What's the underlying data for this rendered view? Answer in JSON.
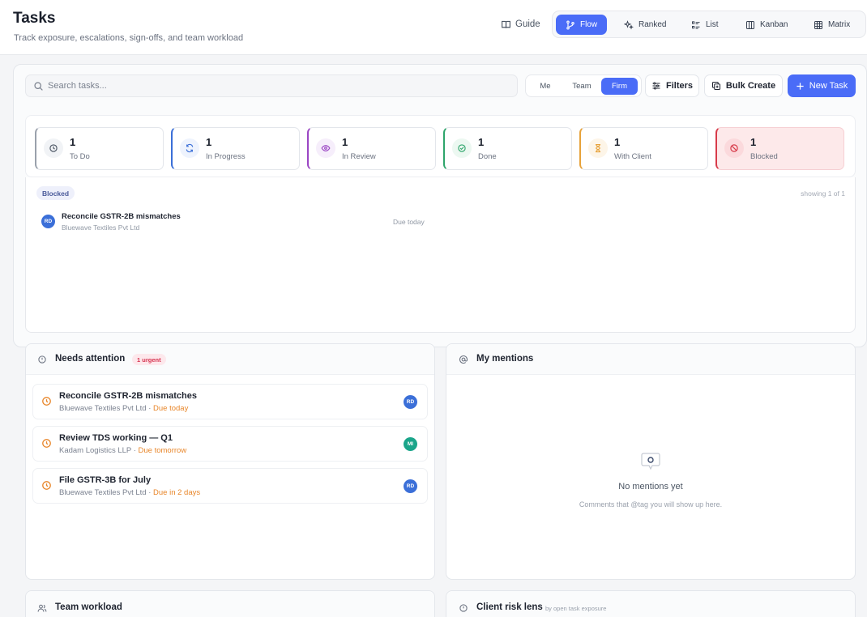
{
  "header": {
    "title": "Tasks",
    "subtitle": "Track exposure, escalations, sign-offs, and team workload",
    "guide_label": "Guide",
    "views": [
      {
        "label": "Flow",
        "icon": "branch-icon",
        "active": true
      },
      {
        "label": "Ranked",
        "icon": "sparkle-icon",
        "active": false
      },
      {
        "label": "List",
        "icon": "list-icon",
        "active": false
      },
      {
        "label": "Kanban",
        "icon": "columns-icon",
        "active": false
      },
      {
        "label": "Matrix",
        "icon": "grid-icon",
        "active": false
      }
    ]
  },
  "toolbar": {
    "search_placeholder": "Search tasks...",
    "scopes": [
      {
        "label": "Me",
        "active": false
      },
      {
        "label": "Team",
        "active": false
      },
      {
        "label": "Firm",
        "active": true
      }
    ],
    "filters_label": "Filters",
    "bulk_create_label": "Bulk Create",
    "new_task_label": "New Task"
  },
  "status_cards": [
    {
      "count": "1",
      "label": "To Do",
      "icon": "clock-icon",
      "color": "#6b7280"
    },
    {
      "count": "1",
      "label": "In Progress",
      "icon": "refresh-icon",
      "color": "#3b6fd8"
    },
    {
      "count": "1",
      "label": "In Review",
      "icon": "eye-icon",
      "color": "#9b46c4"
    },
    {
      "count": "1",
      "label": "Done",
      "icon": "check-circle-icon",
      "color": "#2ea56b"
    },
    {
      "count": "1",
      "label": "With Client",
      "icon": "hourglass-icon",
      "color": "#e7a23a"
    },
    {
      "count": "1",
      "label": "Blocked",
      "icon": "ban-icon",
      "color": "#d73a49"
    }
  ],
  "task_list": {
    "filter_badge": "Blocked",
    "showing": "showing 1 of 1",
    "rows": [
      {
        "initials": "RD",
        "title": "Reconcile GSTR-2B mismatches",
        "client": "Bluewave Textiles Pvt Ltd",
        "due": "Due today"
      }
    ]
  },
  "needs_attention": {
    "title": "Needs attention",
    "badge": "1 urgent",
    "items": [
      {
        "title": "Reconcile GSTR-2B mismatches",
        "client": "Bluewave Textiles Pvt Ltd",
        "sep": " · ",
        "due": "Due today",
        "initials": "RD",
        "avatar_color": "#3b6fd8"
      },
      {
        "title": "Review TDS working — Q1",
        "client": "Kadam Logistics LLP",
        "sep": " · ",
        "due": "Due tomorrow",
        "initials": "MI",
        "avatar_color": "#1aa58a"
      },
      {
        "title": "File GSTR-3B for July",
        "client": "Bluewave Textiles Pvt Ltd",
        "sep": " · ",
        "due": "Due in 2 days",
        "initials": "RD",
        "avatar_color": "#3b6fd8"
      }
    ]
  },
  "mentions": {
    "title": "My mentions",
    "empty_title": "No mentions yet",
    "empty_subtitle": "Comments that @tag you will show up here."
  },
  "team_workload": {
    "title": "Team workload"
  },
  "client_risk": {
    "title": "Client risk lens",
    "subtitle": "by open task exposure"
  },
  "colors": {
    "accent": "#4a6cf7",
    "warning": "#e8862a",
    "danger": "#d73a49"
  }
}
